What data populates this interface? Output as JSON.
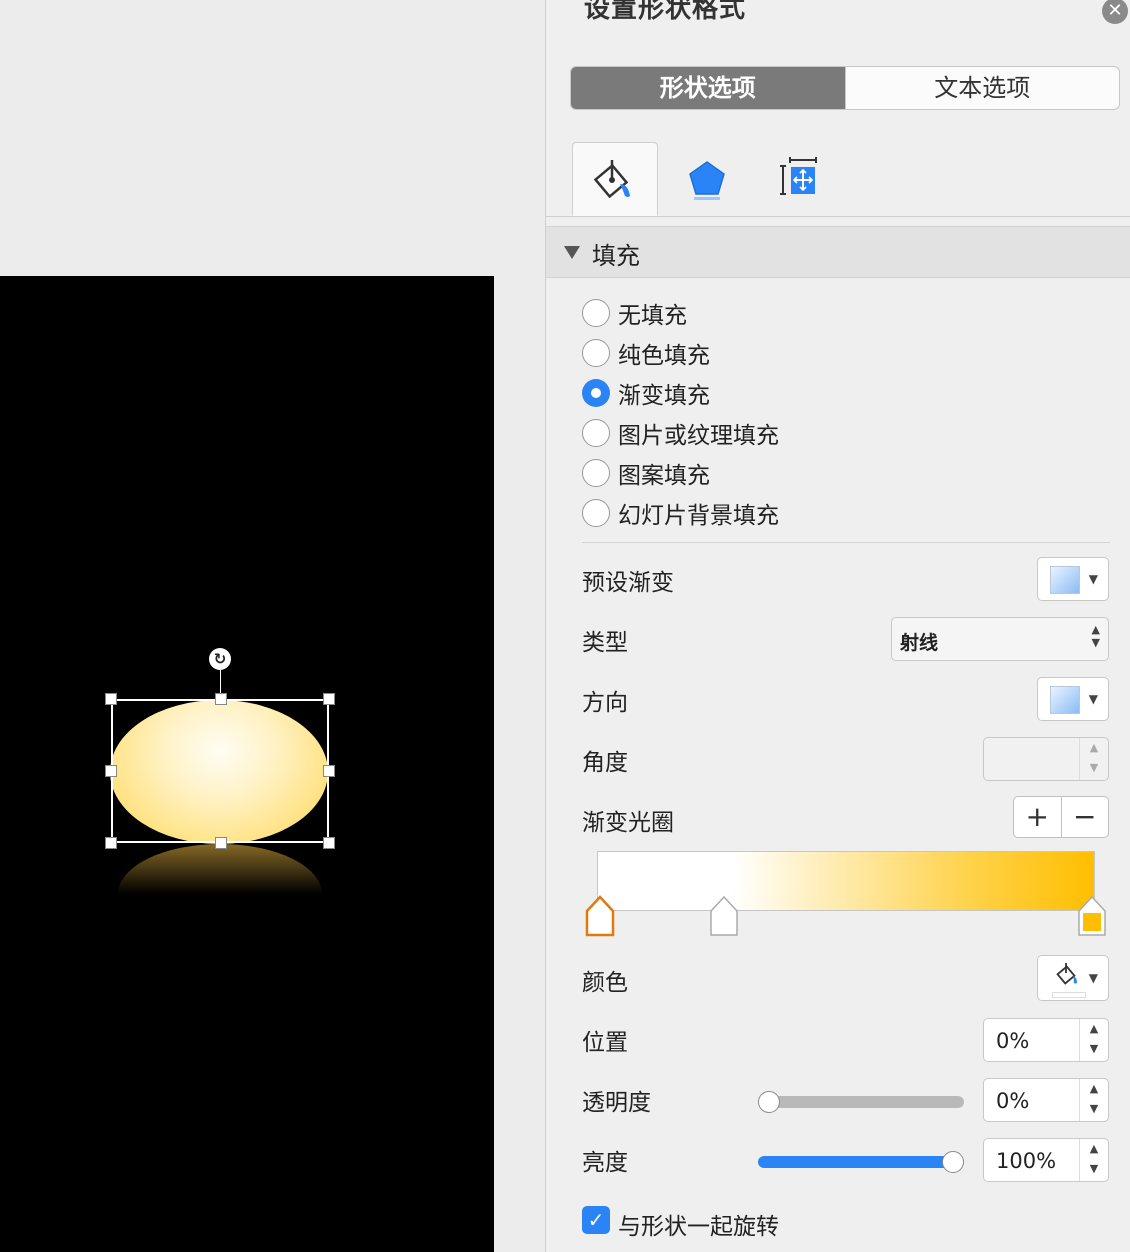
{
  "panel": {
    "title": "设置形状格式",
    "close_label": "✕",
    "tabs": [
      {
        "label": "形状选项",
        "active": true
      },
      {
        "label": "文本选项",
        "active": false
      }
    ],
    "icon_tabs": [
      {
        "icon": "fill-bucket-icon",
        "selected": true
      },
      {
        "icon": "pentagon-effects-icon",
        "selected": false
      },
      {
        "icon": "size-layout-icon",
        "selected": false
      }
    ]
  },
  "fill": {
    "section_label": "填充",
    "options": [
      {
        "label": "无填充",
        "selected": false
      },
      {
        "label": "纯色填充",
        "selected": false
      },
      {
        "label": "渐变填充",
        "selected": true
      },
      {
        "label": "图片或纹理填充",
        "selected": false
      },
      {
        "label": "图案填充",
        "selected": false
      },
      {
        "label": "幻灯片背景填充",
        "selected": false
      }
    ],
    "preset_label": "预设渐变",
    "type_label": "类型",
    "type_value": "射线",
    "direction_label": "方向",
    "angle_label": "角度",
    "angle_value": "",
    "stops_label": "渐变光圈",
    "add_stop": "+",
    "remove_stop": "−",
    "gradient_stops": [
      {
        "position": 0,
        "color": "#ffffff",
        "selected": true
      },
      {
        "position": 27,
        "color": "#ffffff",
        "selected": false
      },
      {
        "position": 100,
        "color": "#ffbe00",
        "selected": false
      }
    ],
    "color_label": "颜色",
    "position_label": "位置",
    "position_value": "0%",
    "transparency_label": "透明度",
    "transparency_value": "0%",
    "transparency_level": 0,
    "brightness_label": "亮度",
    "brightness_value": "100%",
    "brightness_level": 100,
    "rotate_label": "与形状一起旋转",
    "rotate_checked": true
  },
  "colors": {
    "accent": "#2a84f5",
    "gradient_end": "#ffbe00",
    "slide_bg": "#000000"
  }
}
